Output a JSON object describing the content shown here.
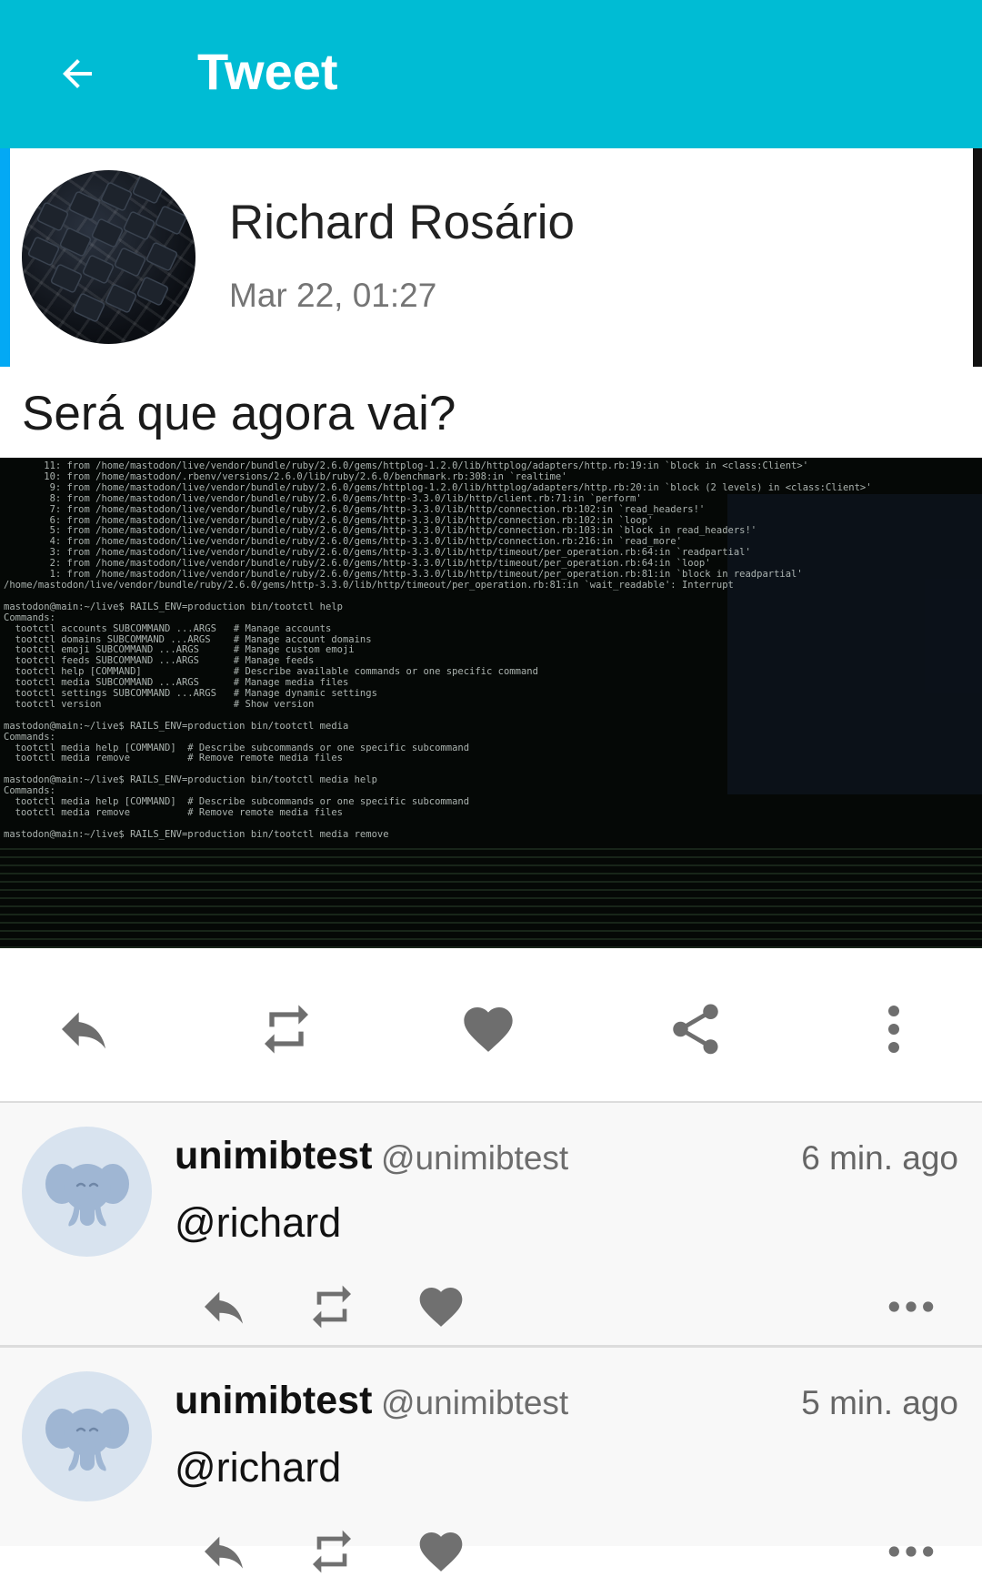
{
  "appbar": {
    "title": "Tweet",
    "back_icon": "arrow-left-icon",
    "color": "#00BCD4"
  },
  "status": {
    "author_name": "Richard Rosário",
    "timestamp": "Mar 22, 01:27",
    "text": "Será que agora vai?",
    "accent_color": "#03A9F4"
  },
  "media": {
    "terminal_lines": [
      "       11: from /home/mastodon/live/vendor/bundle/ruby/2.6.0/gems/httplog-1.2.0/lib/httplog/adapters/http.rb:19:in `block in <class:Client>'",
      "       10: from /home/mastodon/.rbenv/versions/2.6.0/lib/ruby/2.6.0/benchmark.rb:308:in `realtime'",
      "        9: from /home/mastodon/live/vendor/bundle/ruby/2.6.0/gems/httplog-1.2.0/lib/httplog/adapters/http.rb:20:in `block (2 levels) in <class:Client>'",
      "        8: from /home/mastodon/live/vendor/bundle/ruby/2.6.0/gems/http-3.3.0/lib/http/client.rb:71:in `perform'",
      "        7: from /home/mastodon/live/vendor/bundle/ruby/2.6.0/gems/http-3.3.0/lib/http/connection.rb:102:in `read_headers!'",
      "        6: from /home/mastodon/live/vendor/bundle/ruby/2.6.0/gems/http-3.3.0/lib/http/connection.rb:102:in `loop'",
      "        5: from /home/mastodon/live/vendor/bundle/ruby/2.6.0/gems/http-3.3.0/lib/http/connection.rb:103:in `block in read_headers!'",
      "        4: from /home/mastodon/live/vendor/bundle/ruby/2.6.0/gems/http-3.3.0/lib/http/connection.rb:216:in `read_more'",
      "        3: from /home/mastodon/live/vendor/bundle/ruby/2.6.0/gems/http-3.3.0/lib/http/timeout/per_operation.rb:64:in `readpartial'",
      "        2: from /home/mastodon/live/vendor/bundle/ruby/2.6.0/gems/http-3.3.0/lib/http/timeout/per_operation.rb:64:in `loop'",
      "        1: from /home/mastodon/live/vendor/bundle/ruby/2.6.0/gems/http-3.3.0/lib/http/timeout/per_operation.rb:81:in `block in readpartial'",
      "/home/mastodon/live/vendor/bundle/ruby/2.6.0/gems/http-3.3.0/lib/http/timeout/per_operation.rb:81:in `wait_readable': Interrupt",
      "",
      "mastodon@main:~/live$ RAILS_ENV=production bin/tootctl help",
      "Commands:",
      "  tootctl accounts SUBCOMMAND ...ARGS   # Manage accounts",
      "  tootctl domains SUBCOMMAND ...ARGS    # Manage account domains",
      "  tootctl emoji SUBCOMMAND ...ARGS      # Manage custom emoji",
      "  tootctl feeds SUBCOMMAND ...ARGS      # Manage feeds",
      "  tootctl help [COMMAND]                # Describe available commands or one specific command",
      "  tootctl media SUBCOMMAND ...ARGS      # Manage media files",
      "  tootctl settings SUBCOMMAND ...ARGS   # Manage dynamic settings",
      "  tootctl version                       # Show version",
      "",
      "mastodon@main:~/live$ RAILS_ENV=production bin/tootctl media",
      "Commands:",
      "  tootctl media help [COMMAND]  # Describe subcommands or one specific subcommand",
      "  tootctl media remove          # Remove remote media files",
      "",
      "mastodon@main:~/live$ RAILS_ENV=production bin/tootctl media help",
      "Commands:",
      "  tootctl media help [COMMAND]  # Describe subcommands or one specific subcommand",
      "  tootctl media remove          # Remove remote media files",
      "",
      "mastodon@main:~/live$ RAILS_ENV=production bin/tootctl media remove"
    ]
  },
  "actions": [
    {
      "icon": "reply-icon"
    },
    {
      "icon": "boost-icon"
    },
    {
      "icon": "favourite-icon"
    },
    {
      "icon": "share-icon"
    },
    {
      "icon": "more-vertical-icon"
    }
  ],
  "replies": [
    {
      "display_name": "unimibtest",
      "handle": "@unimibtest",
      "time": "6 min. ago",
      "text": "@richard"
    },
    {
      "display_name": "unimibtest",
      "handle": "@unimibtest",
      "time": "5 min. ago",
      "text": "@richard"
    }
  ]
}
